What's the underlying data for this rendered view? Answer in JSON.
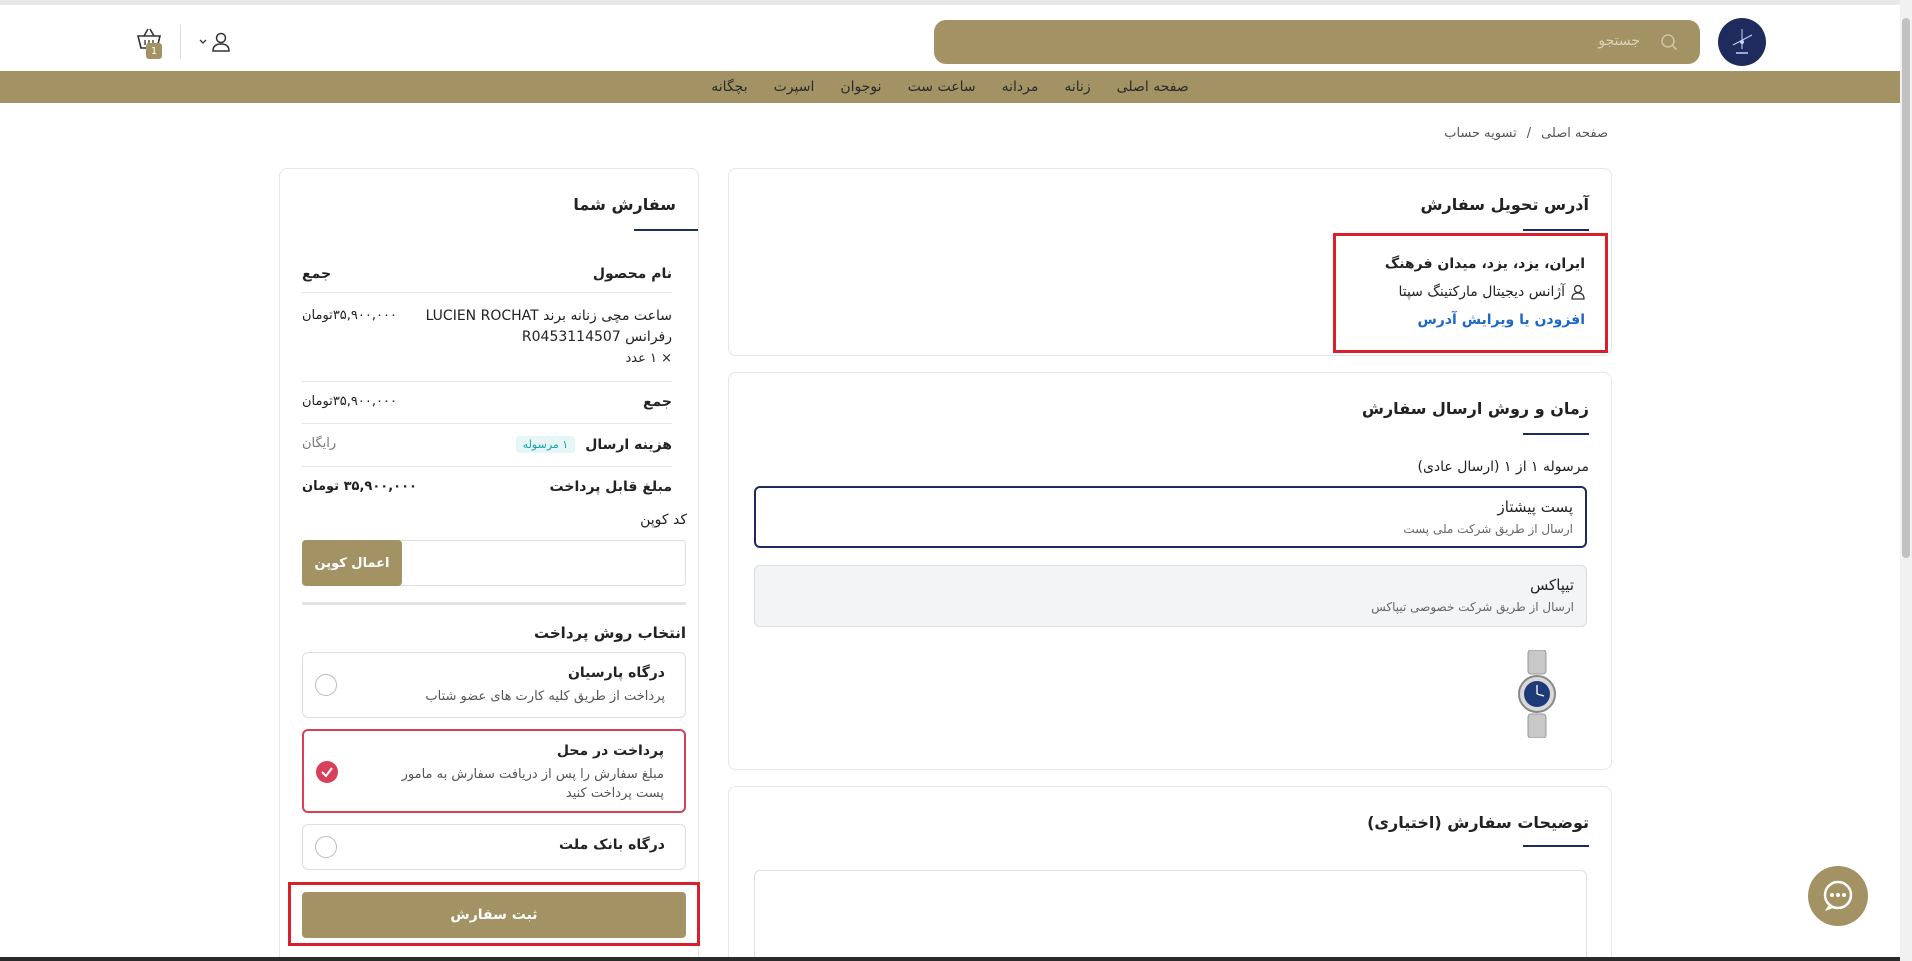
{
  "header": {
    "search_placeholder": "جستجو",
    "cart_count": "1",
    "icons": {
      "logo": "watch-logo-icon",
      "search": "search-icon",
      "user": "user-icon",
      "chevron": "chevron-down-icon",
      "cart": "basket-icon"
    }
  },
  "nav": {
    "items": [
      "صفحه اصلی",
      "زنانه",
      "مردانه",
      "ساعت ست",
      "نوجوان",
      "اسپرت",
      "بچگانه"
    ]
  },
  "breadcrumb": {
    "home": "صفحه اصلی",
    "separator": "/",
    "current": "تسویه حساب"
  },
  "address": {
    "title": "آدرس تحویل سفارش",
    "line": "ایران، یزد، یزد، میدان فرهنگ",
    "recipient": "آژانس دیجیتال مارکتینگ سپتا",
    "edit_link": "افزودن یا ویرایش آدرس"
  },
  "shipping": {
    "title": "زمان و روش ارسال سفارش",
    "parcel_label": "مرسوله ۱ از ۱ (ارسال عادی)",
    "options": [
      {
        "title": "پست پیشتاز",
        "desc": "ارسال از طریق شرکت ملی پست",
        "selected": true
      },
      {
        "title": "تیپاکس",
        "desc": "ارسال از طریق شرکت خصوصی تیپاکس",
        "selected": false
      }
    ],
    "product_image": "watch-product-image"
  },
  "notes": {
    "title": "توضیحات سفارش (اختیاری)"
  },
  "order": {
    "title": "سفارش شما",
    "col_product": "نام محصول",
    "col_total": "جمع",
    "item_name_line1": "ساعت مچی زنانه برند LUCIEN ROCHAT",
    "item_name_line2": "رفرانس R0453114507",
    "item_qty": "× ۱ عدد",
    "item_price": "۳۵,۹۰۰,۰۰۰تومان",
    "subtotal_label": "جمع",
    "subtotal_value": "۳۵,۹۰۰,۰۰۰تومان",
    "shipping_label": "هزینه ارسال",
    "shipping_badge": "۱ مرسوله",
    "shipping_value": "رایگان",
    "payable_label": "مبلغ قابل پرداخت",
    "payable_value": "۳۵,۹۰۰,۰۰۰ تومان",
    "coupon_label": "کد کوپن",
    "coupon_placeholder": "",
    "coupon_button": "اعمال کوپن",
    "payment_title": "انتخاب روش پرداخت",
    "payment_methods": [
      {
        "title": "درگاه پارسیان",
        "desc": "پرداخت از طریق کلیه کارت های عضو شتاب",
        "selected": false
      },
      {
        "title": "پرداخت در محل",
        "desc": "مبلغ سفارش را پس از دریافت سفارش به مامور پست پرداخت کنید",
        "selected": true
      },
      {
        "title": "درگاه بانک ملت",
        "desc": "",
        "selected": false
      }
    ],
    "submit_button": "ثبت سفارش"
  },
  "colors": {
    "brand": "#a39264",
    "navy": "#1e2b5c",
    "highlight": "#d91f2b",
    "link": "#1c68c9"
  }
}
